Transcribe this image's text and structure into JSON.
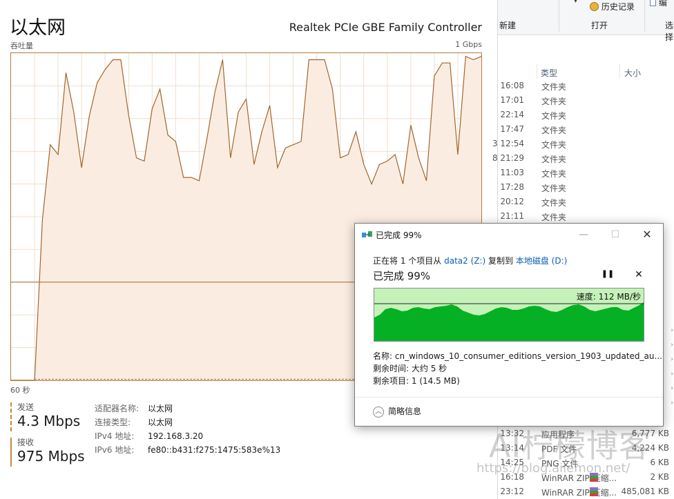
{
  "taskmgr": {
    "title": "以太网",
    "adapter_name": "Realtek PCIe GBE Family Controller",
    "throughput_label": "吞吐量",
    "max_label": "1 Gbps",
    "time_label": "60 秒",
    "send": {
      "label": "发送",
      "value": "4.3 Mbps"
    },
    "receive": {
      "label": "接收",
      "value": "975 Mbps"
    },
    "properties": [
      {
        "key": "适配器名称:",
        "value": "以太网"
      },
      {
        "key": "连接类型:",
        "value": "以太网"
      },
      {
        "key": "IPv4 地址:",
        "value": "192.168.3.20"
      },
      {
        "key": "IPv6 地址:",
        "value": "fe80::b431:f275:1475:583e%13"
      }
    ],
    "colors": {
      "line": "#a0662c",
      "fill": "#fbece2",
      "grid": "#f1ddcc",
      "border": "#b5793b"
    }
  },
  "chart_data": {
    "type": "area",
    "title": "",
    "xlabel": "60 秒",
    "ylabel": "吞吐量",
    "ylim": [
      0,
      1
    ],
    "y_unit": "Gbps",
    "x": [
      0,
      1,
      2,
      3,
      4,
      5,
      6,
      7,
      8,
      9,
      10,
      11,
      12,
      13,
      14,
      15,
      16,
      17,
      18,
      19,
      20,
      21,
      22,
      23,
      24,
      25,
      26,
      27,
      28,
      29,
      30,
      31,
      32,
      33,
      34,
      35,
      36,
      37,
      38,
      39,
      40,
      41,
      42,
      43,
      44,
      45,
      46,
      47,
      48,
      49,
      50,
      51,
      52,
      53,
      54,
      55,
      56,
      57,
      58,
      59,
      60
    ],
    "series": [
      {
        "values": [
          0,
          0,
          0,
          0,
          0.49,
          0.72,
          0.69,
          0.94,
          0.82,
          0.65,
          0.81,
          0.91,
          0.95,
          0.98,
          0.98,
          0.81,
          0.68,
          0.67,
          0.83,
          0.89,
          0.75,
          0.73,
          0.62,
          0.62,
          0.61,
          0.74,
          0.88,
          0.98,
          0.68,
          0.82,
          0.86,
          0.66,
          0.76,
          0.84,
          0.65,
          0.71,
          0.72,
          0.73,
          0.98,
          0.98,
          0.98,
          0.89,
          0.68,
          0.69,
          0.76,
          0.66,
          0.6,
          0.66,
          0.67,
          0.69,
          0.6,
          0.78,
          0.68,
          0.61,
          0.93,
          0.97,
          0.97,
          0.69,
          0.99,
          0.98,
          0.99
        ],
        "color": "#a0662c"
      }
    ],
    "grid": true,
    "legend": "none"
  },
  "explorer": {
    "ribbon": {
      "new_label": "新建",
      "open_label": "打开",
      "select_label": "选择",
      "history_label": "历史记录",
      "edit_label": "编"
    },
    "columns": {
      "type": "类型",
      "size": "大小"
    },
    "rows": [
      {
        "date": "16:08",
        "type": "文件夹",
        "size": ""
      },
      {
        "date": "17:01",
        "type": "文件夹",
        "size": ""
      },
      {
        "date": "22:14",
        "type": "文件夹",
        "size": ""
      },
      {
        "date": "17:47",
        "type": "文件夹",
        "size": ""
      },
      {
        "date": "3 12:54",
        "type": "文件夹",
        "size": ""
      },
      {
        "date": "8 21:29",
        "type": "文件夹",
        "size": ""
      },
      {
        "date": "11:03",
        "type": "文件夹",
        "size": ""
      },
      {
        "date": "17:28",
        "type": "文件夹",
        "size": ""
      },
      {
        "date": "20:12",
        "type": "文件夹",
        "size": ""
      },
      {
        "date": "21:11",
        "type": "文件夹",
        "size": ""
      },
      {
        "date": "13:32",
        "type": "应用程序",
        "size": "6,777 KB"
      },
      {
        "date": "13:14",
        "type": "PDF 文件",
        "size": "4,224 KB"
      },
      {
        "date": "14:25",
        "type": "PNG 文件",
        "size": "6 KB"
      },
      {
        "date": "16:18",
        "type": "WinRAR ZIP 压缩...",
        "size": "2 KB"
      },
      {
        "date": "23:12",
        "type": "WinRAR ZIP 压缩...",
        "size": "485,081 KB"
      }
    ]
  },
  "copy_dialog": {
    "title": "已完成 99%",
    "desc_prefix": "正在将 1 个项目从 ",
    "source": "data2 (Z:)",
    "desc_mid": " 复制到 ",
    "dest": "本地磁盘 (D:)",
    "percent_text": "已完成 99%",
    "progress": 0.99,
    "speed": "速度: 112 MB/秒",
    "name_label": "名称:",
    "name_value": "cn_windows_10_consumer_editions_version_1903_updated_au...",
    "time_label": "剩余时间:",
    "time_value": "大约 5 秒",
    "items_label": "剩余项目:",
    "items_value": "1 (14.5 MB)",
    "less_info": "简略信息",
    "colors": {
      "graph_bg": "#c4f2b8",
      "graph_fill": "#06b025"
    }
  },
  "watermark": {
    "title": "AI柠檬博客",
    "url": "https://blog.ailemon.net/"
  }
}
